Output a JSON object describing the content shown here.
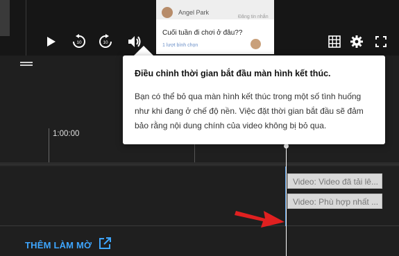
{
  "player": {
    "controls": [
      "play-icon",
      "rewind-10-icon",
      "forward-10-icon",
      "volume-icon",
      "grid-icon",
      "gear-icon",
      "fullscreen-icon"
    ],
    "skip_seconds": "10"
  },
  "preview": {
    "channel_name": "Angel Park",
    "subscribe_chip": "Đăng tin nhắn",
    "question": "Cuối tuần đi chơi ở đâu??",
    "footer": "1 lượt bình chọn"
  },
  "tooltip": {
    "title": "Điều chỉnh thời gian bắt đầu màn hình kết thúc.",
    "body": "Bạn có thể bỏ qua màn hình kết thúc trong một số tình huống như khi đang ở chế độ nền. Việc đặt thời gian bắt đầu sẽ đảm bảo rằng nội dung chính của video không bị bỏ qua."
  },
  "timeline": {
    "time_label": "1:00:00"
  },
  "endscreen_elements": [
    {
      "label": "Video: Video đã tải lê..."
    },
    {
      "label": "Video: Phù hợp nhất ..."
    }
  ],
  "actions": {
    "add_blur_label": "THÊM LÀM MỜ"
  },
  "colors": {
    "accent": "#3ea6ff",
    "arrow": "#e02020",
    "background": "#1f1f1f"
  }
}
